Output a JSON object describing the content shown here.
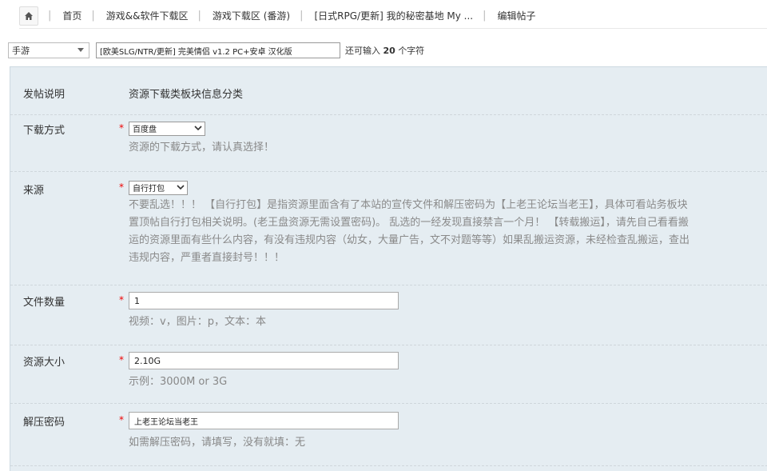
{
  "breadcrumb": {
    "items": [
      {
        "label": "首页"
      },
      {
        "label": "游戏&&软件下载区"
      },
      {
        "label": "游戏下载区 (番游)"
      },
      {
        "label": "[日式RPG/更新] 我的秘密基地 My ..."
      },
      {
        "label": "编辑帖子"
      }
    ]
  },
  "title_row": {
    "type_select_value": "手游",
    "title_value": "[欧美SLG/NTR/更新] 完美情侣 v1.2 PC+安卓 汉化版",
    "hint_prefix": "还可输入",
    "hint_count": "20",
    "hint_suffix": "个字符"
  },
  "form": {
    "post_desc": {
      "label": "发帖说明",
      "value": "资源下载类板块信息分类"
    },
    "download": {
      "label": "下载方式",
      "select_value": "百度盘",
      "hint": "资源的下载方式，请认真选择！"
    },
    "source": {
      "label": "来源",
      "select_value": "自行打包",
      "hint_lines": [
        "不要乱选！！！ 【自行打包】是指资源里面含有了本站的宣传文件和解压密码为【上老王论坛当老王】，具体可看站务板块",
        "置顶帖自行打包相关说明。(老王盘资源无需设置密码)。 乱选的一经发现直接禁言一个月！ 【转载搬运】，请先自己看看搬",
        "运的资源里面有些什么内容，有没有违规内容（幼女，大量广告，文不对题等等）如果乱搬运资源，未经检查乱搬运，查出",
        "违规内容，严重者直接封号！！！"
      ]
    },
    "file_count": {
      "label": "文件数量",
      "value": "1",
      "hint": "视频：v，图片：p，文本：本"
    },
    "size": {
      "label": "资源大小",
      "value": "2.10G",
      "hint": "示例：3000M or 3G"
    },
    "password": {
      "label": "解压密码",
      "value": "上老王论坛当老王",
      "hint": "如需解压密码，请填写，没有就填：无"
    }
  },
  "icons": {
    "home": "home-icon",
    "dropdown": "chevron-down-icon"
  }
}
